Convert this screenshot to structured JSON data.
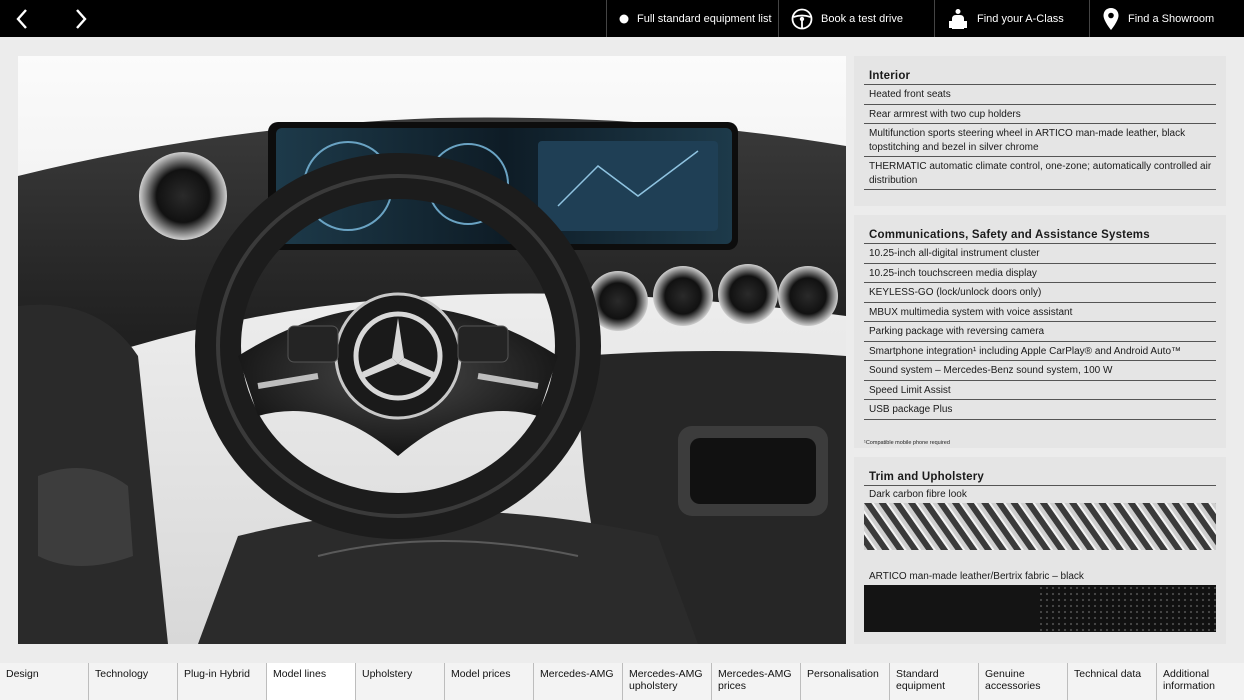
{
  "topbar": {
    "equipment_list": "Full standard equipment list",
    "test_drive": "Book a test drive",
    "find_class": "Find your A-Class",
    "showroom": "Find a Showroom"
  },
  "interior": {
    "title": "Interior",
    "items": [
      "Heated front seats",
      "Rear armrest with two cup holders",
      "Multifunction sports steering wheel in ARTICO man-made leather, black topstitching and bezel in silver chrome",
      "THERMATIC automatic climate control, one-zone; automatically controlled air distribution"
    ]
  },
  "comms": {
    "title": "Communications, Safety and Assistance Systems",
    "items": [
      "10.25-inch all-digital instrument cluster",
      "10.25-inch touchscreen media display",
      "KEYLESS-GO (lock/unlock doors only)",
      "MBUX multimedia system with voice assistant",
      "Parking package with reversing camera",
      "Smartphone integration¹ including Apple CarPlay® and Android Auto™",
      "Sound system – Mercedes-Benz sound system, 100 W",
      "Speed Limit Assist",
      "USB package Plus"
    ],
    "footnote": "¹Compatible mobile phone required"
  },
  "trim": {
    "title": "Trim and Upholstery",
    "item1": "Dark carbon fibre look",
    "item2": "ARTICO man-made leather/Bertrix fabric – black"
  },
  "nav": {
    "tabs": [
      "Design",
      "Technology",
      "Plug-in Hybrid",
      "Model lines",
      "Upholstery",
      "Model prices",
      "Mercedes-AMG",
      "Mercedes-AMG upholstery",
      "Mercedes-AMG prices",
      "Personalisation",
      "Standard equipment",
      "Genuine accessories",
      "Technical data",
      "Additional information"
    ],
    "active_index": 3
  },
  "colors": {
    "topbar": "#000000",
    "panel": "#e5e5e5",
    "page": "#ececec"
  }
}
